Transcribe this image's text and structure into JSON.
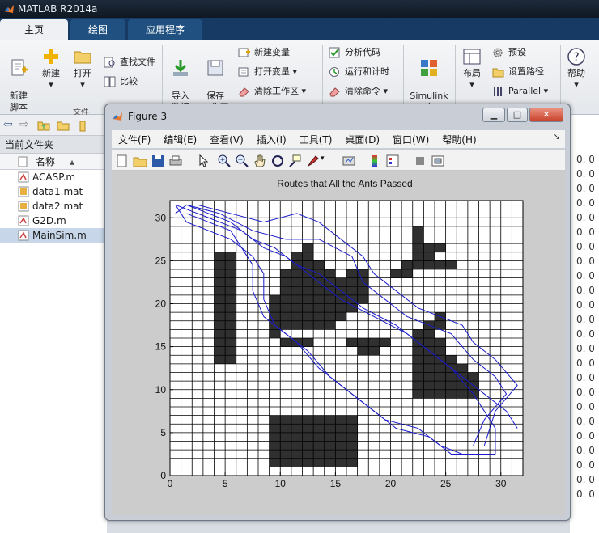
{
  "app": {
    "title": "MATLAB R2014a"
  },
  "tabs": [
    "主页",
    "绘图",
    "应用程序"
  ],
  "ribbon": {
    "new_script": "新建\n脚本",
    "new": "新建",
    "open": "打开",
    "find_files": "查找文件",
    "compare": "比较",
    "file_group": "文件",
    "import": "导入\n数据",
    "save_ws": "保存\n工作区",
    "new_var": "新建变量",
    "open_var": "打开变量",
    "clear_ws": "清除工作区",
    "analyze": "分析代码",
    "run_time": "运行和计时",
    "clear_cmd": "清除命令",
    "simulink": "Simulink\n库",
    "layout": "布局",
    "prefs": "预设",
    "set_path": "设置路径",
    "parallel": "Parallel",
    "help": "帮助"
  },
  "browser": {
    "current_folder": "当前文件夹",
    "col_name": "名称",
    "files": [
      {
        "name": "ACASP.m",
        "kind": "m"
      },
      {
        "name": "data1.mat",
        "kind": "mat"
      },
      {
        "name": "data2.mat",
        "kind": "mat"
      },
      {
        "name": "G2D.m",
        "kind": "m"
      },
      {
        "name": "MainSim.m",
        "kind": "m"
      }
    ]
  },
  "workspace_values": [
    "0. 0",
    "0. 0",
    "0. 0",
    "0. 0",
    "0. 0",
    "0. 0",
    "0. 0",
    "0. 0",
    "0. 0",
    "0. 0",
    "0. 0",
    "0. 0",
    "0. 0",
    "0. 0",
    "0. 0",
    "0. 0",
    "0. 0",
    "0. 0",
    "0. 0",
    "0. 0",
    "0. 0",
    "0. 0",
    "0. 0",
    "0. 0"
  ],
  "figure": {
    "title": "Figure 3",
    "menus": [
      "文件(F)",
      "编辑(E)",
      "查看(V)",
      "插入(I)",
      "工具(T)",
      "桌面(D)",
      "窗口(W)",
      "帮助(H)"
    ],
    "plot_title": "Routes that All the Ants Passed"
  },
  "colors": {
    "obstacle": "#303030",
    "route": "#1a1acc",
    "tab_bar": "#163a63"
  },
  "chart_data": {
    "type": "heatmap",
    "title": "Routes that All the Ants Passed",
    "xlim": [
      0,
      32
    ],
    "ylim": [
      0,
      32
    ],
    "xticks": [
      0,
      5,
      10,
      15,
      20,
      25,
      30
    ],
    "yticks": [
      0,
      5,
      10,
      15,
      20,
      25,
      30
    ],
    "grid": true,
    "obstacle_cells": [
      [
        4,
        13,
        2,
        13
      ],
      [
        9,
        1,
        8,
        6
      ],
      [
        9,
        16,
        1,
        1
      ],
      [
        10,
        15,
        3,
        1
      ],
      [
        9,
        17,
        6,
        1
      ],
      [
        9,
        18,
        7,
        1
      ],
      [
        9,
        19,
        8,
        1
      ],
      [
        9,
        20,
        8,
        1
      ],
      [
        10,
        21,
        7,
        1
      ],
      [
        10,
        22,
        7,
        1
      ],
      [
        10,
        23,
        5,
        1
      ],
      [
        11,
        24,
        3,
        1
      ],
      [
        11,
        25,
        2,
        1
      ],
      [
        12,
        26,
        1,
        1
      ],
      [
        16,
        20,
        2,
        4
      ],
      [
        16,
        15,
        4,
        1
      ],
      [
        17,
        14,
        2,
        1
      ],
      [
        19,
        15,
        1,
        1
      ],
      [
        22,
        9,
        6,
        3
      ],
      [
        22,
        12,
        5,
        1
      ],
      [
        22,
        13,
        4,
        1
      ],
      [
        22,
        14,
        3,
        1
      ],
      [
        22,
        15,
        3,
        1
      ],
      [
        22,
        16,
        2,
        1
      ],
      [
        23,
        17,
        2,
        1
      ],
      [
        24,
        18,
        1,
        1
      ],
      [
        20,
        23,
        2,
        1
      ],
      [
        21,
        24,
        5,
        1
      ],
      [
        22,
        25,
        2,
        1
      ],
      [
        22,
        26,
        3,
        1
      ],
      [
        22,
        27,
        1,
        1
      ],
      [
        22,
        28,
        1,
        1
      ]
    ],
    "routes": [
      [
        [
          0.5,
          31.5
        ],
        [
          2.5,
          30.5
        ],
        [
          4.5,
          29.5
        ],
        [
          6.5,
          28.5
        ],
        [
          8.5,
          26.5
        ],
        [
          10.5,
          25.5
        ],
        [
          13.5,
          22.5
        ],
        [
          15.5,
          20.5
        ],
        [
          18.5,
          18.5
        ],
        [
          21.5,
          16.5
        ],
        [
          23.5,
          14.5
        ],
        [
          25.5,
          12.5
        ],
        [
          27.5,
          9.5
        ],
        [
          28.5,
          7.5
        ],
        [
          29.5,
          5.5
        ],
        [
          29.5,
          2.5
        ]
      ],
      [
        [
          0.5,
          30.5
        ],
        [
          1.5,
          31.5
        ],
        [
          3.5,
          30.5
        ],
        [
          5.5,
          29.5
        ],
        [
          7.5,
          27.5
        ],
        [
          9.5,
          26.5
        ],
        [
          11.5,
          24.5
        ],
        [
          13.5,
          23.5
        ],
        [
          15.5,
          21.5
        ],
        [
          17.5,
          19.5
        ],
        [
          20.5,
          17.5
        ],
        [
          22.5,
          15.5
        ],
        [
          24.5,
          13.5
        ],
        [
          26.5,
          11.5
        ],
        [
          28.5,
          9.5
        ],
        [
          30.5,
          7.5
        ],
        [
          31.5,
          5.5
        ]
      ],
      [
        [
          0.5,
          31.5
        ],
        [
          1.5,
          29.5
        ],
        [
          3.5,
          28.5
        ],
        [
          5.5,
          27.5
        ],
        [
          7.5,
          25.5
        ],
        [
          8.5,
          23.5
        ],
        [
          8.5,
          20.5
        ],
        [
          9.5,
          17.5
        ],
        [
          11.5,
          15.5
        ],
        [
          13.5,
          12.5
        ],
        [
          15.5,
          10.5
        ],
        [
          17.5,
          8.5
        ],
        [
          19.5,
          6.5
        ],
        [
          22.5,
          5.5
        ],
        [
          24.5,
          3.5
        ],
        [
          26.5,
          2.5
        ],
        [
          29.5,
          2.5
        ]
      ],
      [
        [
          1.5,
          30.5
        ],
        [
          3.5,
          29.5
        ],
        [
          5.5,
          28.5
        ],
        [
          6.5,
          26.5
        ],
        [
          7.5,
          24.5
        ],
        [
          7.5,
          21.5
        ],
        [
          8.5,
          18.5
        ],
        [
          10.5,
          16.5
        ],
        [
          12.5,
          14.5
        ],
        [
          14.5,
          11.5
        ],
        [
          16.5,
          9.5
        ],
        [
          18.5,
          7.5
        ],
        [
          20.5,
          5.5
        ],
        [
          23.5,
          4.5
        ],
        [
          25.5,
          2.5
        ],
        [
          28.5,
          2.5
        ]
      ],
      [
        [
          2.5,
          31.5
        ],
        [
          5.5,
          30.5
        ],
        [
          8.5,
          29.5
        ],
        [
          11.5,
          30.5
        ],
        [
          13.5,
          29.5
        ],
        [
          15.5,
          27.5
        ],
        [
          17.5,
          25.5
        ],
        [
          18.5,
          23.5
        ],
        [
          20.5,
          21.5
        ],
        [
          22.5,
          19.5
        ],
        [
          24.5,
          18.5
        ],
        [
          26.5,
          17.5
        ],
        [
          27.5,
          15.5
        ],
        [
          29.5,
          13.5
        ],
        [
          31.5,
          10.5
        ],
        [
          29.5,
          7.5
        ],
        [
          28.5,
          3.5
        ]
      ],
      [
        [
          1.5,
          31.5
        ],
        [
          4.5,
          30.5
        ],
        [
          7.5,
          28.5
        ],
        [
          10.5,
          27.5
        ],
        [
          13.5,
          27.5
        ],
        [
          16.5,
          25.5
        ],
        [
          17.5,
          22.5
        ],
        [
          19.5,
          20.5
        ],
        [
          21.5,
          18.5
        ],
        [
          23.5,
          17.5
        ],
        [
          25.5,
          16.5
        ],
        [
          27.5,
          13.5
        ],
        [
          29.5,
          11.5
        ],
        [
          30.5,
          9.5
        ],
        [
          28.5,
          6.5
        ],
        [
          27.5,
          3.5
        ]
      ]
    ]
  }
}
